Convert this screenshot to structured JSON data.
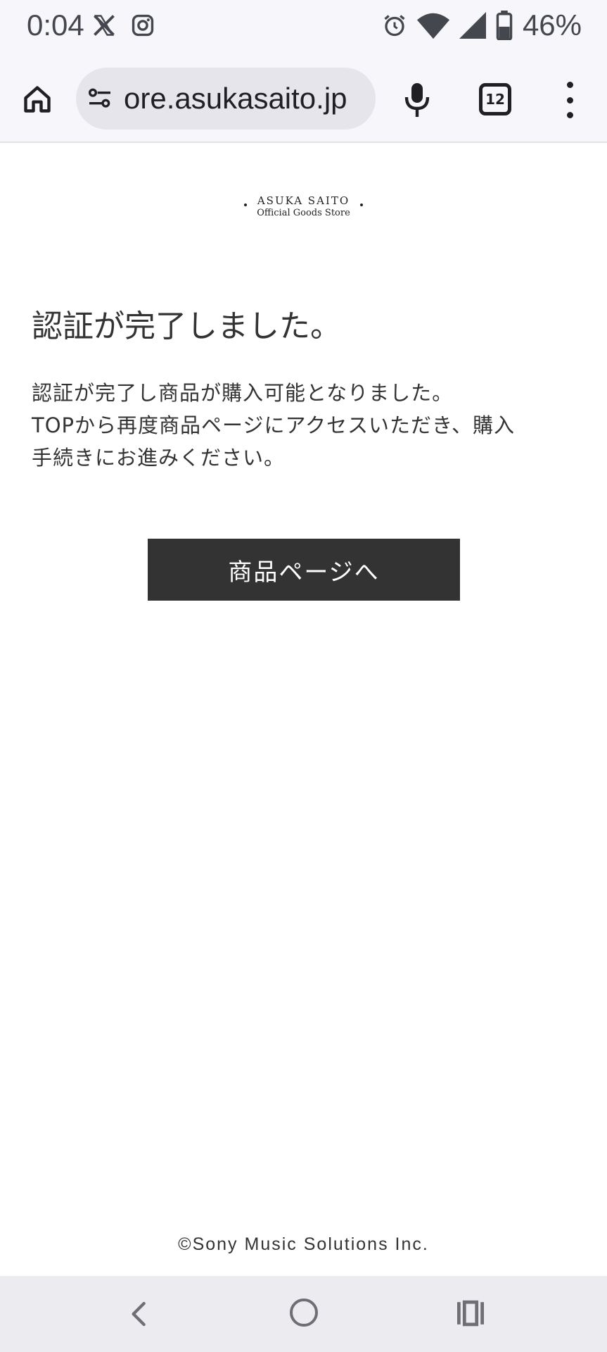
{
  "status_bar": {
    "time": "0:04",
    "left_icons": [
      "x-app-icon",
      "instagram-icon"
    ],
    "right_icons": [
      "alarm-icon",
      "wifi-icon",
      "signal-icon",
      "battery-icon"
    ],
    "battery": "46%"
  },
  "browser": {
    "url": "ore.asukasaito.jp",
    "tab_count": "12"
  },
  "page": {
    "logo": {
      "line1": "ASUKA SAITO",
      "line2": "Official Goods Store"
    },
    "heading": "認証が完了しました。",
    "message_lines": [
      "認証が完了し商品が購入可能となりました。",
      "TOPから再度商品ページにアクセスいただき、購入",
      "手続きにお進みください。"
    ],
    "button_label": "商品ページへ",
    "footer": "©Sony Music Solutions Inc."
  },
  "colors": {
    "button_bg": "#333333",
    "chrome_bg": "#f7f6fb",
    "omnibox_bg": "#e6e5ec",
    "navbar_bg": "#ebebf0"
  }
}
